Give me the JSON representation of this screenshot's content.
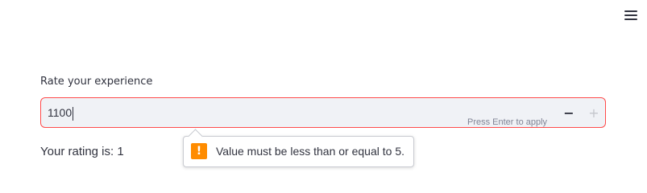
{
  "header": {
    "menu_icon": "hamburger-menu-icon"
  },
  "number_input": {
    "label": "Rate your experience",
    "value": "1100",
    "hint": "Press Enter to apply",
    "decrement_symbol": "−",
    "increment_symbol": "+",
    "border_color": "#ff4b4b",
    "background_color": "#f0f2f6"
  },
  "validation_tooltip": {
    "icon": "warning-icon",
    "icon_symbol": "!",
    "icon_color": "#ff8c00",
    "message": "Value must be less than or equal to 5."
  },
  "output": {
    "rating_text": "Your rating is: 1"
  }
}
